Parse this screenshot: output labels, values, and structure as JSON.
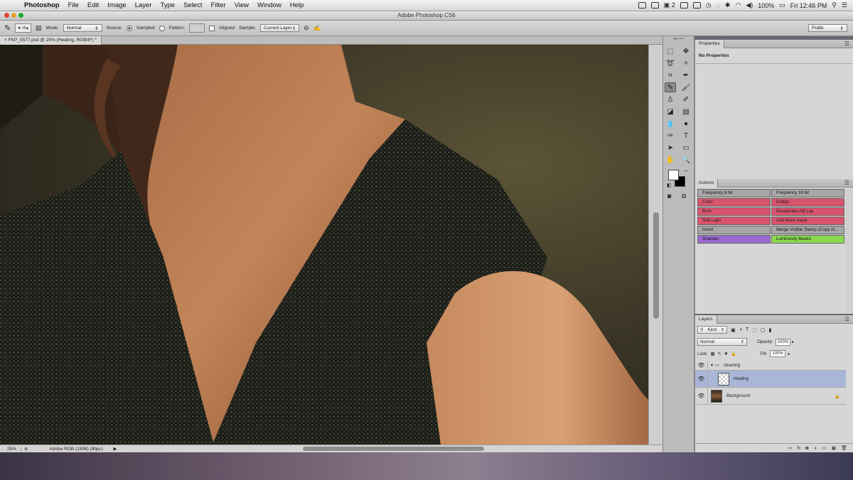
{
  "menubar": {
    "app": "Photoshop",
    "items": [
      "File",
      "Edit",
      "Image",
      "Layer",
      "Type",
      "Select",
      "Filter",
      "View",
      "Window",
      "Help"
    ],
    "right": {
      "adobe_count": "2",
      "battery": "100%",
      "clock": "Fri 12:46 PM"
    }
  },
  "window": {
    "title": "Adobe Photoshop CS6"
  },
  "options": {
    "brush_size": "25",
    "mode_label": "Mode:",
    "mode_value": "Normal",
    "source_label": "Source:",
    "sampled_label": "Sampled",
    "pattern_label": "Pattern:",
    "aligned_label": "Aligned",
    "sample_label": "Sample:",
    "sample_value": "Current Layer",
    "workspace": "Pratik"
  },
  "document": {
    "tab_title": "FKP_0577.psd @ 25% (Healing, RGB/8*) *",
    "zoom": "25%",
    "doc_info": "Adobe RGB (1998) (8bpc)"
  },
  "properties": {
    "tab": "Properties",
    "empty_text": "No Properties"
  },
  "actions": {
    "tab": "Actions",
    "buttons": [
      {
        "label": "Frequency 8 bit",
        "color": "gray"
      },
      {
        "label": "Frequency 16 bit",
        "color": "gray"
      },
      {
        "label": "Color",
        "color": "red"
      },
      {
        "label": "Dodge",
        "color": "red"
      },
      {
        "label": "Burn",
        "color": "red"
      },
      {
        "label": "Desaturate Adj Lay",
        "color": "red"
      },
      {
        "label": "Soft Light",
        "color": "red"
      },
      {
        "label": "Add black mask",
        "color": "red"
      },
      {
        "label": "Invert",
        "color": "gray"
      },
      {
        "label": "Merge Visible Stamp (Copy of...",
        "color": "gray"
      },
      {
        "label": "Sharpen",
        "color": "purple"
      },
      {
        "label": "Luminosity Masks",
        "color": "green"
      }
    ]
  },
  "layers": {
    "tab": "Layers",
    "kind": "Kind",
    "blend_mode": "Normal",
    "opacity_label": "Opacity:",
    "opacity": "100%",
    "lock_label": "Lock:",
    "fill_label": "Fill:",
    "fill": "100%",
    "items": [
      {
        "name": "cleaning",
        "type": "group"
      },
      {
        "name": "Healing",
        "type": "layer",
        "selected": true
      },
      {
        "name": "Background",
        "type": "background"
      }
    ]
  }
}
